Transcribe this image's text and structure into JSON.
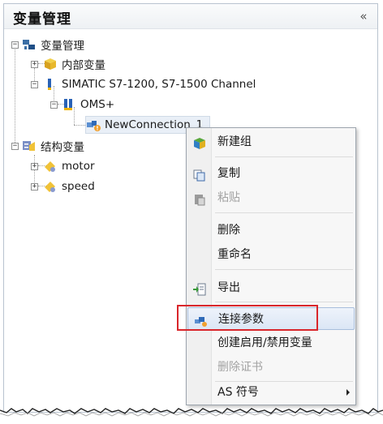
{
  "panel": {
    "title": "变量管理",
    "collapse_label": "«"
  },
  "tree": {
    "root": "变量管理",
    "internal": "内部变量",
    "channel": "SIMATIC S7-1200, S7-1500 Channel",
    "oms": "OMS+",
    "connection": "NewConnection_1",
    "struct_root": "结构变量",
    "motor": "motor",
    "speed": "speed"
  },
  "context_menu": {
    "new_group": "新建组",
    "copy": "复制",
    "paste": "粘贴",
    "delete": "删除",
    "rename": "重命名",
    "export": "导出",
    "connection_params": "连接参数",
    "create_enable": "创建启用/禁用变量",
    "delete_cert": "删除证书",
    "as_symbol": "AS 符号"
  },
  "colors": {
    "highlight_border": "#d9262b",
    "menu_hover": "#dbe6f5"
  },
  "icons": {
    "root": "network-icon",
    "internal": "yellow-cube-icon",
    "channel": "channel-icon",
    "connection": "connection-warning-icon",
    "struct": "struct-icon"
  }
}
